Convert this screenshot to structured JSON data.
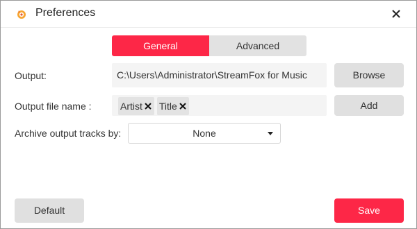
{
  "window": {
    "title": "Preferences",
    "app_icon": "streamfox-logo-icon",
    "close_icon": "close-icon"
  },
  "tabs": [
    {
      "label": "General",
      "active": true
    },
    {
      "label": "Advanced",
      "active": false
    }
  ],
  "output": {
    "label": "Output:",
    "value": "C:\\Users\\Administrator\\StreamFox for Music",
    "button_label": "Browse"
  },
  "output_file_name": {
    "label": "Output file name :",
    "tags": [
      "Artist",
      "Title"
    ],
    "tag_remove_icon": "x-icon",
    "button_label": "Add"
  },
  "archive": {
    "label": "Archive output tracks by:",
    "selected": "None",
    "caret_icon": "caret-down-icon"
  },
  "footer": {
    "default_label": "Default",
    "save_label": "Save"
  },
  "colors": {
    "accent": "#fd2747",
    "button_gray": "#e0e0e0",
    "field_bg": "#f4f4f4"
  }
}
